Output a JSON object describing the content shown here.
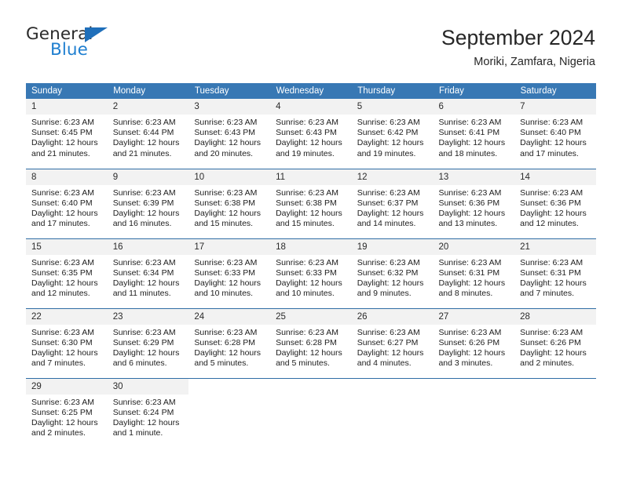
{
  "brand": {
    "name_top": "General",
    "name_bottom": "Blue",
    "accent_color": "#1f7fd0",
    "triangle_color": "#1f6fba"
  },
  "header": {
    "title": "September 2024",
    "location": "Moriki, Zamfara, Nigeria"
  },
  "calendar": {
    "header_color": "#3878b4",
    "daynum_band_color": "#f2f2f2",
    "weekday_headers": [
      "Sunday",
      "Monday",
      "Tuesday",
      "Wednesday",
      "Thursday",
      "Friday",
      "Saturday"
    ],
    "weeks": [
      [
        {
          "day": "1",
          "sunrise": "Sunrise: 6:23 AM",
          "sunset": "Sunset: 6:45 PM",
          "daylight1": "Daylight: 12 hours",
          "daylight2": "and 21 minutes."
        },
        {
          "day": "2",
          "sunrise": "Sunrise: 6:23 AM",
          "sunset": "Sunset: 6:44 PM",
          "daylight1": "Daylight: 12 hours",
          "daylight2": "and 21 minutes."
        },
        {
          "day": "3",
          "sunrise": "Sunrise: 6:23 AM",
          "sunset": "Sunset: 6:43 PM",
          "daylight1": "Daylight: 12 hours",
          "daylight2": "and 20 minutes."
        },
        {
          "day": "4",
          "sunrise": "Sunrise: 6:23 AM",
          "sunset": "Sunset: 6:43 PM",
          "daylight1": "Daylight: 12 hours",
          "daylight2": "and 19 minutes."
        },
        {
          "day": "5",
          "sunrise": "Sunrise: 6:23 AM",
          "sunset": "Sunset: 6:42 PM",
          "daylight1": "Daylight: 12 hours",
          "daylight2": "and 19 minutes."
        },
        {
          "day": "6",
          "sunrise": "Sunrise: 6:23 AM",
          "sunset": "Sunset: 6:41 PM",
          "daylight1": "Daylight: 12 hours",
          "daylight2": "and 18 minutes."
        },
        {
          "day": "7",
          "sunrise": "Sunrise: 6:23 AM",
          "sunset": "Sunset: 6:40 PM",
          "daylight1": "Daylight: 12 hours",
          "daylight2": "and 17 minutes."
        }
      ],
      [
        {
          "day": "8",
          "sunrise": "Sunrise: 6:23 AM",
          "sunset": "Sunset: 6:40 PM",
          "daylight1": "Daylight: 12 hours",
          "daylight2": "and 17 minutes."
        },
        {
          "day": "9",
          "sunrise": "Sunrise: 6:23 AM",
          "sunset": "Sunset: 6:39 PM",
          "daylight1": "Daylight: 12 hours",
          "daylight2": "and 16 minutes."
        },
        {
          "day": "10",
          "sunrise": "Sunrise: 6:23 AM",
          "sunset": "Sunset: 6:38 PM",
          "daylight1": "Daylight: 12 hours",
          "daylight2": "and 15 minutes."
        },
        {
          "day": "11",
          "sunrise": "Sunrise: 6:23 AM",
          "sunset": "Sunset: 6:38 PM",
          "daylight1": "Daylight: 12 hours",
          "daylight2": "and 15 minutes."
        },
        {
          "day": "12",
          "sunrise": "Sunrise: 6:23 AM",
          "sunset": "Sunset: 6:37 PM",
          "daylight1": "Daylight: 12 hours",
          "daylight2": "and 14 minutes."
        },
        {
          "day": "13",
          "sunrise": "Sunrise: 6:23 AM",
          "sunset": "Sunset: 6:36 PM",
          "daylight1": "Daylight: 12 hours",
          "daylight2": "and 13 minutes."
        },
        {
          "day": "14",
          "sunrise": "Sunrise: 6:23 AM",
          "sunset": "Sunset: 6:36 PM",
          "daylight1": "Daylight: 12 hours",
          "daylight2": "and 12 minutes."
        }
      ],
      [
        {
          "day": "15",
          "sunrise": "Sunrise: 6:23 AM",
          "sunset": "Sunset: 6:35 PM",
          "daylight1": "Daylight: 12 hours",
          "daylight2": "and 12 minutes."
        },
        {
          "day": "16",
          "sunrise": "Sunrise: 6:23 AM",
          "sunset": "Sunset: 6:34 PM",
          "daylight1": "Daylight: 12 hours",
          "daylight2": "and 11 minutes."
        },
        {
          "day": "17",
          "sunrise": "Sunrise: 6:23 AM",
          "sunset": "Sunset: 6:33 PM",
          "daylight1": "Daylight: 12 hours",
          "daylight2": "and 10 minutes."
        },
        {
          "day": "18",
          "sunrise": "Sunrise: 6:23 AM",
          "sunset": "Sunset: 6:33 PM",
          "daylight1": "Daylight: 12 hours",
          "daylight2": "and 10 minutes."
        },
        {
          "day": "19",
          "sunrise": "Sunrise: 6:23 AM",
          "sunset": "Sunset: 6:32 PM",
          "daylight1": "Daylight: 12 hours",
          "daylight2": "and 9 minutes."
        },
        {
          "day": "20",
          "sunrise": "Sunrise: 6:23 AM",
          "sunset": "Sunset: 6:31 PM",
          "daylight1": "Daylight: 12 hours",
          "daylight2": "and 8 minutes."
        },
        {
          "day": "21",
          "sunrise": "Sunrise: 6:23 AM",
          "sunset": "Sunset: 6:31 PM",
          "daylight1": "Daylight: 12 hours",
          "daylight2": "and 7 minutes."
        }
      ],
      [
        {
          "day": "22",
          "sunrise": "Sunrise: 6:23 AM",
          "sunset": "Sunset: 6:30 PM",
          "daylight1": "Daylight: 12 hours",
          "daylight2": "and 7 minutes."
        },
        {
          "day": "23",
          "sunrise": "Sunrise: 6:23 AM",
          "sunset": "Sunset: 6:29 PM",
          "daylight1": "Daylight: 12 hours",
          "daylight2": "and 6 minutes."
        },
        {
          "day": "24",
          "sunrise": "Sunrise: 6:23 AM",
          "sunset": "Sunset: 6:28 PM",
          "daylight1": "Daylight: 12 hours",
          "daylight2": "and 5 minutes."
        },
        {
          "day": "25",
          "sunrise": "Sunrise: 6:23 AM",
          "sunset": "Sunset: 6:28 PM",
          "daylight1": "Daylight: 12 hours",
          "daylight2": "and 5 minutes."
        },
        {
          "day": "26",
          "sunrise": "Sunrise: 6:23 AM",
          "sunset": "Sunset: 6:27 PM",
          "daylight1": "Daylight: 12 hours",
          "daylight2": "and 4 minutes."
        },
        {
          "day": "27",
          "sunrise": "Sunrise: 6:23 AM",
          "sunset": "Sunset: 6:26 PM",
          "daylight1": "Daylight: 12 hours",
          "daylight2": "and 3 minutes."
        },
        {
          "day": "28",
          "sunrise": "Sunrise: 6:23 AM",
          "sunset": "Sunset: 6:26 PM",
          "daylight1": "Daylight: 12 hours",
          "daylight2": "and 2 minutes."
        }
      ],
      [
        {
          "day": "29",
          "sunrise": "Sunrise: 6:23 AM",
          "sunset": "Sunset: 6:25 PM",
          "daylight1": "Daylight: 12 hours",
          "daylight2": "and 2 minutes."
        },
        {
          "day": "30",
          "sunrise": "Sunrise: 6:23 AM",
          "sunset": "Sunset: 6:24 PM",
          "daylight1": "Daylight: 12 hours",
          "daylight2": "and 1 minute."
        },
        {
          "day": "",
          "sunrise": "",
          "sunset": "",
          "daylight1": "",
          "daylight2": ""
        },
        {
          "day": "",
          "sunrise": "",
          "sunset": "",
          "daylight1": "",
          "daylight2": ""
        },
        {
          "day": "",
          "sunrise": "",
          "sunset": "",
          "daylight1": "",
          "daylight2": ""
        },
        {
          "day": "",
          "sunrise": "",
          "sunset": "",
          "daylight1": "",
          "daylight2": ""
        },
        {
          "day": "",
          "sunrise": "",
          "sunset": "",
          "daylight1": "",
          "daylight2": ""
        }
      ]
    ]
  }
}
